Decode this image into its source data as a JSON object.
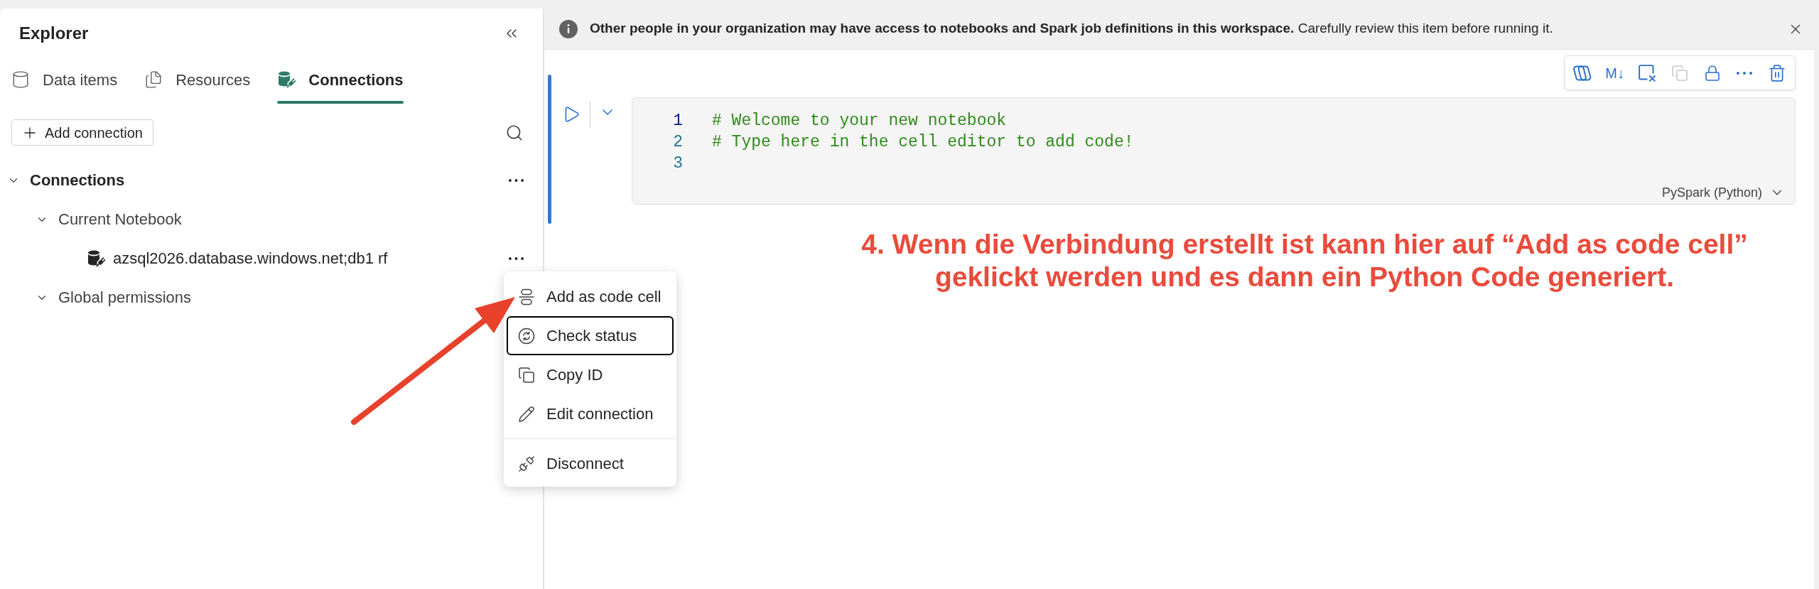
{
  "explorer": {
    "title": "Explorer",
    "tabs": [
      {
        "label": "Data items",
        "selected": false
      },
      {
        "label": "Resources",
        "selected": false
      },
      {
        "label": "Connections",
        "selected": true
      }
    ],
    "add_button": {
      "label": "Add connection"
    },
    "tree": [
      {
        "kind": "group",
        "label": "Connections",
        "expanded": true,
        "more_button": true,
        "children": [
          {
            "kind": "group",
            "label": "Current Notebook",
            "expanded": true,
            "more_button": false,
            "children": [
              {
                "kind": "connection",
                "label": "azsql2026.database.windows.net;db1 rf",
                "more_button": true
              }
            ]
          },
          {
            "kind": "group",
            "label": "Global permissions",
            "expanded": true,
            "more_button": false
          }
        ]
      }
    ]
  },
  "context_menu": {
    "sections": [
      {
        "items": [
          {
            "label": "Add as code cell",
            "focused": false
          },
          {
            "label": "Check status",
            "focused": true
          },
          {
            "label": "Copy ID",
            "focused": false
          },
          {
            "label": "Edit connection",
            "focused": false
          }
        ]
      },
      {
        "items": [
          {
            "label": "Disconnect",
            "focused": false
          }
        ]
      }
    ]
  },
  "banner": {
    "text": "**Other people in your organization may have access to notebooks and Spark job definitions in this workspace.** Carefully review this item before running it."
  },
  "cell": {
    "selected": true,
    "toolbar": [
      {
        "kind": "icon",
        "disabled": false
      },
      {
        "kind": "text",
        "label": "M↓",
        "disabled": false
      },
      {
        "kind": "icon",
        "disabled": false
      },
      {
        "kind": "icon",
        "disabled": true
      },
      {
        "kind": "icon",
        "disabled": false
      },
      {
        "kind": "icon",
        "disabled": false
      },
      {
        "kind": "icon",
        "disabled": false
      }
    ],
    "lines": [
      {
        "number": "1",
        "text": "# Welcome to your new notebook",
        "current": true
      },
      {
        "number": "2",
        "text": "# Type here in the cell editor to add code!",
        "current": false
      },
      {
        "number": "3",
        "current": false
      }
    ],
    "language": "PySpark (Python)"
  },
  "annotation": {
    "text": "4. Wenn die Verbindung erstellt ist kann hier auf “Add as code cell” geklickt werden und es dann ein Python Code generiert."
  }
}
